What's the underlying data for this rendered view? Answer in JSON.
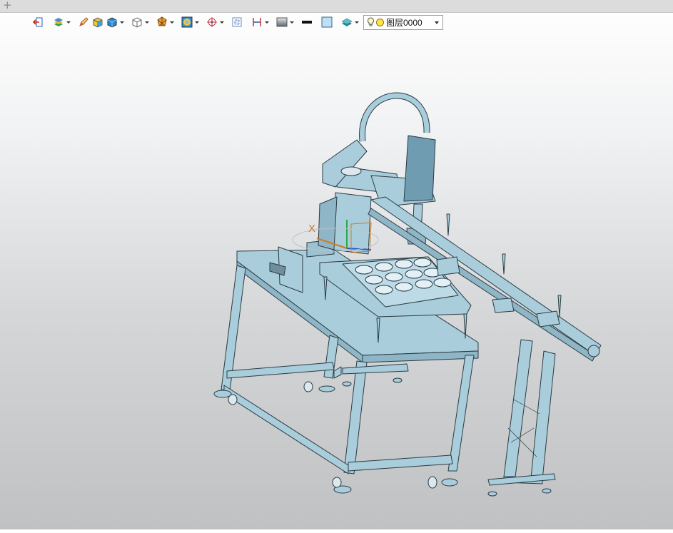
{
  "tabs": {
    "new_tab_symbol": "+"
  },
  "toolbar": {
    "buttons": [
      {
        "name": "exit-sketch-icon",
        "dropdown": false
      },
      {
        "name": "layers-style-icon",
        "dropdown": true
      },
      {
        "name": "pen-edit-icon",
        "dropdown": false
      },
      {
        "name": "solid-box-icon",
        "dropdown": false
      },
      {
        "name": "shaded-cube-icon",
        "dropdown": true
      },
      {
        "name": "wireframe-cube-icon",
        "dropdown": true
      },
      {
        "name": "section-view-icon",
        "dropdown": true
      },
      {
        "name": "texture-icon",
        "dropdown": true
      },
      {
        "name": "origin-icon",
        "dropdown": true
      },
      {
        "name": "zoom-fit-icon",
        "dropdown": false
      },
      {
        "name": "dimension-icon",
        "dropdown": true
      },
      {
        "name": "background-icon",
        "dropdown": true
      },
      {
        "name": "line-width-icon",
        "dropdown": false
      },
      {
        "name": "color-swatch-icon",
        "dropdown": false
      },
      {
        "name": "layer-manager-icon",
        "dropdown": true
      }
    ],
    "layer_select": {
      "value": "图层0000"
    }
  },
  "colors": {
    "model_fill": "#a9cddb",
    "model_stroke": "#2b3b44",
    "axis_x": "#d07a20",
    "axis_y": "#2aa84a",
    "axis_z": "#2b56d6"
  },
  "viewport": {
    "axis_label": "X"
  }
}
